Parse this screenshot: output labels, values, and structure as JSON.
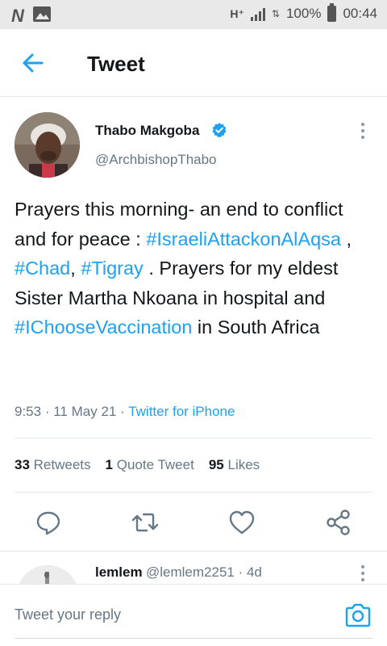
{
  "status_bar": {
    "left_icons": [
      "notification-n-icon",
      "gallery-icon"
    ],
    "network": "H⁺",
    "battery_percent": "100%",
    "time": "00:44"
  },
  "header": {
    "title": "Tweet",
    "back_icon": "arrow-left-icon"
  },
  "tweet": {
    "author_name": "Thabo Makgoba",
    "verified": true,
    "author_handle": "@ArchbishopThabo",
    "text": {
      "p1": "Prayers this morning- an end to conflict and for peace : ",
      "tag1": "#IsraeliAttackonAlAqsa",
      "p2": " , ",
      "tag2": "#Chad",
      "p3": ", ",
      "tag3": "#Tigray",
      "p4": " .  Prayers for my eldest Sister Martha Nkoana in hospital and ",
      "tag4": "#IChooseVaccination",
      "p5": " in South Africa"
    },
    "time": "9:53",
    "date": "11 May 21",
    "separator": "·",
    "source": "Twitter for iPhone"
  },
  "stats": {
    "retweets_count": "33",
    "retweets_label": "Retweets",
    "quotes_count": "1",
    "quotes_label": "Quote Tweet",
    "likes_count": "95",
    "likes_label": "Likes"
  },
  "actions": [
    "reply-icon",
    "retweet-icon",
    "like-icon",
    "share-icon"
  ],
  "reply_preview": {
    "name": "lemlem",
    "handle_and_time": "@lemlem2251 · 4d"
  },
  "composer": {
    "placeholder": "Tweet your reply",
    "camera_icon": "camera-icon"
  },
  "colors": {
    "accent": "#1da1f2",
    "text": "#14171a",
    "muted": "#657786",
    "divider": "#e1e8ed"
  }
}
